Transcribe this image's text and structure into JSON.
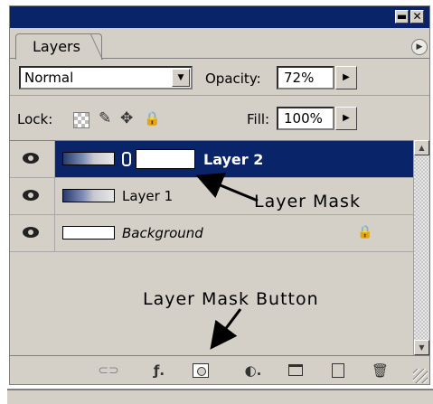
{
  "panel": {
    "title": "",
    "window_buttons": {
      "minimize": "▬",
      "close": "✕"
    },
    "tab": {
      "label": "Layers"
    },
    "menu_icon": "▶"
  },
  "blend": {
    "mode": "Normal",
    "dropdown_icon": "▼",
    "opacity_label": "Opacity:",
    "opacity_value": "72%",
    "opacity_stepper_icon": "▶"
  },
  "lock": {
    "label": "Lock:",
    "icons": [
      "lock-transparency-icon",
      "lock-image-icon",
      "lock-position-icon",
      "lock-all-icon"
    ],
    "brush_glyph": "✎",
    "move_glyph": "✥",
    "all_glyph": "🔒",
    "fill_label": "Fill:",
    "fill_value": "100%",
    "fill_stepper_icon": "▶"
  },
  "layers": [
    {
      "name": "Layer 2",
      "selected": true,
      "has_mask": true,
      "visible": true
    },
    {
      "name": "Layer 1",
      "selected": false,
      "has_mask": false,
      "visible": true
    },
    {
      "name": "Background",
      "selected": false,
      "has_mask": false,
      "visible": true,
      "locked": true,
      "lock_glyph": "🔒"
    }
  ],
  "annotations": {
    "layer_mask": "Layer Mask",
    "layer_mask_button": "Layer Mask Button"
  },
  "toolbar": {
    "link_glyph": "⊂⊃",
    "style_glyph": "ƒ.",
    "adjust_glyph": "◐.",
    "trash_glyph": "🗑"
  },
  "scrollbar": {
    "up": "▲",
    "down": "▼"
  },
  "colors": {
    "titlebar": "#0a246a",
    "panel_bg": "#d4d0c8",
    "selected_row": "#0a246a"
  }
}
